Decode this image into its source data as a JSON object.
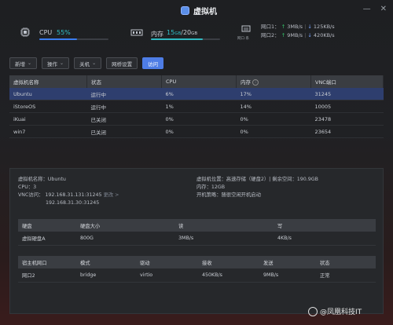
{
  "window": {
    "title": "虚拟机"
  },
  "stats": {
    "cpu": {
      "label": "CPU",
      "value": "55%",
      "percent": 55
    },
    "memory": {
      "label": "内存",
      "used": "15",
      "used_unit": "GB",
      "separator": "/",
      "total": "20",
      "total_unit": "GB",
      "percent": 75
    },
    "network": {
      "icon_caption": "网口·系",
      "ports": [
        {
          "label": "网口1：",
          "up": "3MB/s",
          "down": "125KB/s"
        },
        {
          "label": "网口2：",
          "up": "9MB/s",
          "down": "420KB/s"
        }
      ]
    }
  },
  "toolbar": {
    "buttons": [
      {
        "label": "新增",
        "dropdown": true
      },
      {
        "label": "操作",
        "dropdown": true
      },
      {
        "label": "关机",
        "dropdown": true
      },
      {
        "label": "网桥设置",
        "dropdown": false
      },
      {
        "label": "访问",
        "dropdown": false,
        "primary": true
      }
    ]
  },
  "vm_table": {
    "headers": [
      "虚拟机名称",
      "状态",
      "CPU",
      "内存",
      "VNC端口"
    ],
    "rows": [
      {
        "name": "Ubuntu",
        "status": "运行中",
        "cpu": "6%",
        "mem": "17%",
        "vnc": "31245",
        "selected": true
      },
      {
        "name": "iStoreOS",
        "status": "运行中",
        "cpu": "1%",
        "mem": "14%",
        "vnc": "10005",
        "selected": false
      },
      {
        "name": "iKuai",
        "status": "已关闭",
        "cpu": "0%",
        "mem": "0%",
        "vnc": "23478",
        "selected": false
      },
      {
        "name": "win7",
        "status": "已关闭",
        "cpu": "0%",
        "mem": "0%",
        "vnc": "23654",
        "selected": false
      }
    ]
  },
  "detail": {
    "name": "虚拟机名称：Ubuntu",
    "cpu": "CPU：3",
    "vnc_label": "VNC访问：",
    "vnc_addr1": "192.168.31.131:31245",
    "vnc_more": "更改 >",
    "vnc_addr2": "192.168.31.30:31245",
    "location": "虚拟机位置：高速存储（硬盘2）| 剩余空间：190.9GB",
    "memory": "内存：12GB",
    "autostart": "开机策略：随很空闲开机启动"
  },
  "disk_table": {
    "headers": [
      "硬盘",
      "硬盘大小",
      "读",
      "写"
    ],
    "rows": [
      {
        "disk": "虚拟硬盘A",
        "size": "800G",
        "read": "3MB/s",
        "write": "4KB/s"
      }
    ]
  },
  "nic_table": {
    "headers": [
      "宿主机网口",
      "模式",
      "驱动",
      "接收",
      "发送",
      "状态"
    ],
    "rows": [
      {
        "port": "网口2",
        "mode": "bridge",
        "driver": "virtio",
        "rx": "450KB/s",
        "tx": "9MB/s",
        "status": "正常"
      }
    ]
  },
  "watermark": {
    "text": "@凤凰科技IT"
  }
}
